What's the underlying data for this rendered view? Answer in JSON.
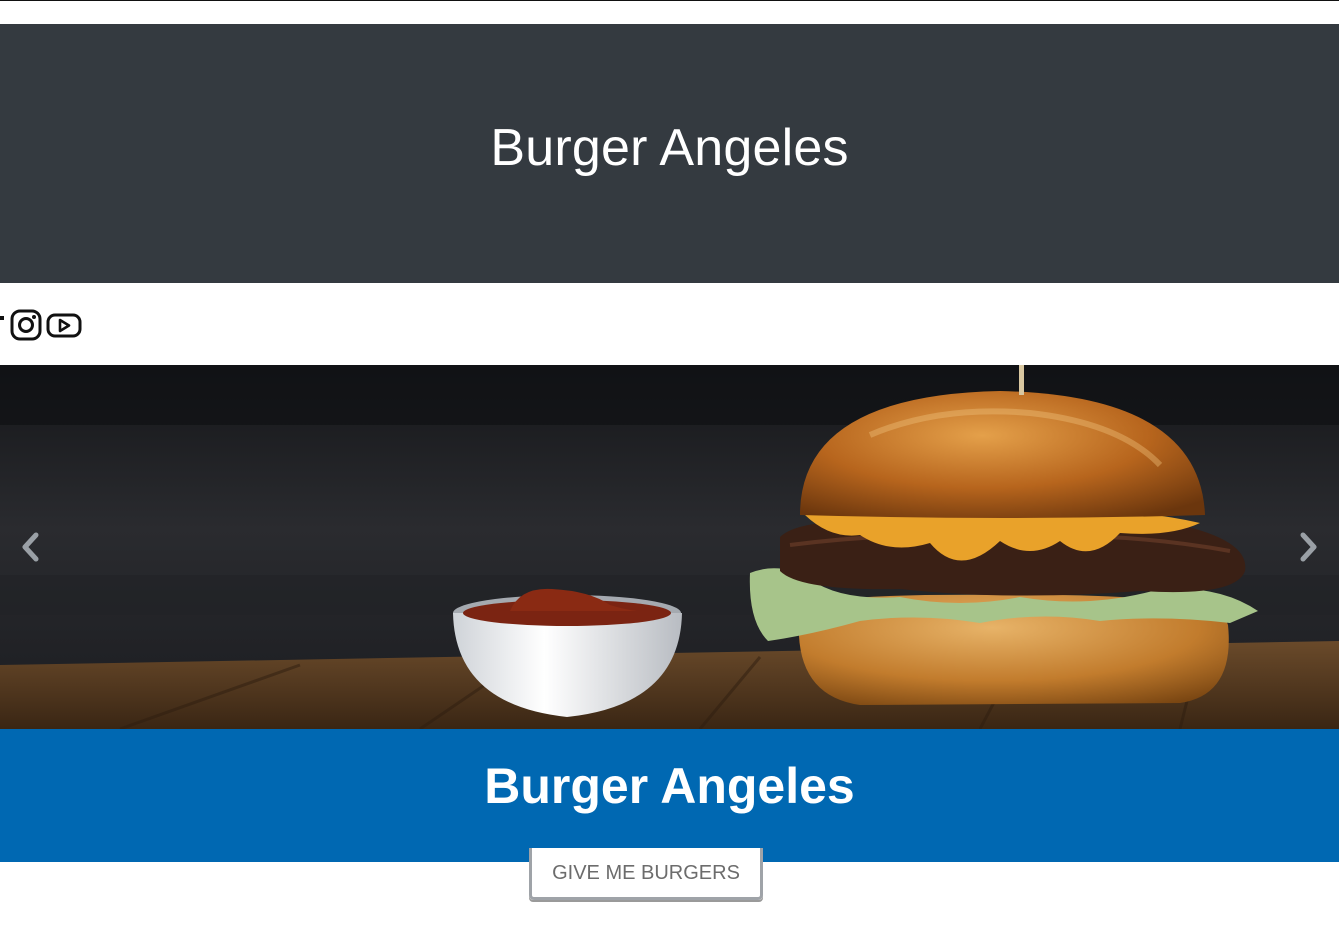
{
  "header": {
    "title": "Burger Angeles"
  },
  "social": {
    "icons": [
      "facebook-icon",
      "instagram-icon",
      "youtube-icon"
    ]
  },
  "carousel": {
    "slide_image": "burger-photo",
    "prev_icon": "chevron-left-icon",
    "next_icon": "chevron-right-icon",
    "caption_title": "Burger Angeles"
  },
  "cta": {
    "label": "GIVE ME BURGERS"
  },
  "colors": {
    "header_bg": "#343a40",
    "caption_bg": "#0068b2",
    "text_light": "#ffffff",
    "button_text": "#6c6c6c"
  }
}
